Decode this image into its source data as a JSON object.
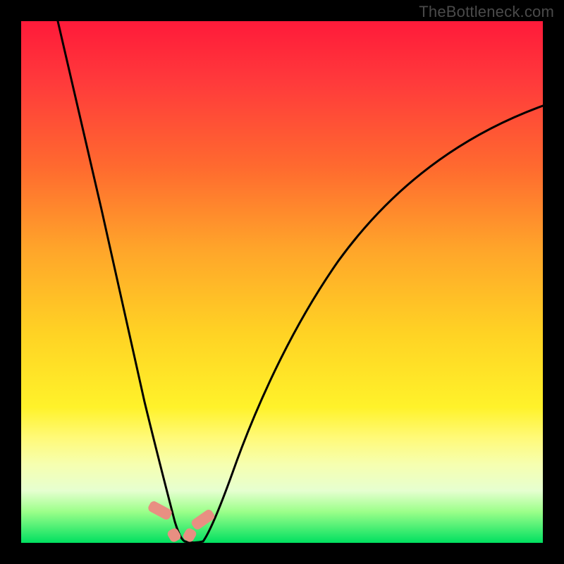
{
  "watermark": "TheBottleneck.com",
  "colors": {
    "frame_bg_top": "#ff1a3a",
    "frame_bg_bottom": "#00e060",
    "curve_stroke": "#000000",
    "marker_fill": "#e88f82",
    "page_bg": "#000000",
    "watermark_text": "#4a4a4a"
  },
  "chart_data": {
    "type": "line",
    "title": "",
    "xlabel": "",
    "ylabel": "",
    "xlim": [
      0,
      100
    ],
    "ylim": [
      0,
      100
    ],
    "series": [
      {
        "name": "left-branch",
        "x": [
          7,
          10,
          13,
          16,
          19,
          22,
          24,
          26,
          28,
          29.5,
          30
        ],
        "y": [
          100,
          80,
          62,
          46,
          32,
          20,
          12,
          6,
          2,
          0.5,
          0
        ]
      },
      {
        "name": "right-branch",
        "x": [
          33,
          35,
          38,
          42,
          48,
          56,
          66,
          78,
          90,
          100
        ],
        "y": [
          0,
          3,
          10,
          22,
          36,
          50,
          62,
          72,
          79,
          84
        ]
      }
    ],
    "markers": [
      {
        "name": "left-marker",
        "x": 26.5,
        "y": 6,
        "w": 2.2,
        "h": 4.5,
        "angle": -62
      },
      {
        "name": "bottom-left-marker",
        "x": 28.7,
        "y": 0.8,
        "w": 2.0,
        "h": 2.2,
        "angle": -30
      },
      {
        "name": "bottom-right-marker",
        "x": 31.8,
        "y": 0.8,
        "w": 2.0,
        "h": 2.2,
        "angle": 30
      },
      {
        "name": "right-marker",
        "x": 34.7,
        "y": 4.2,
        "w": 2.2,
        "h": 4.5,
        "angle": 55
      }
    ],
    "notes": "Axes are unlabeled; values are estimated on a 0–100 normalized scale from pixel positions."
  }
}
